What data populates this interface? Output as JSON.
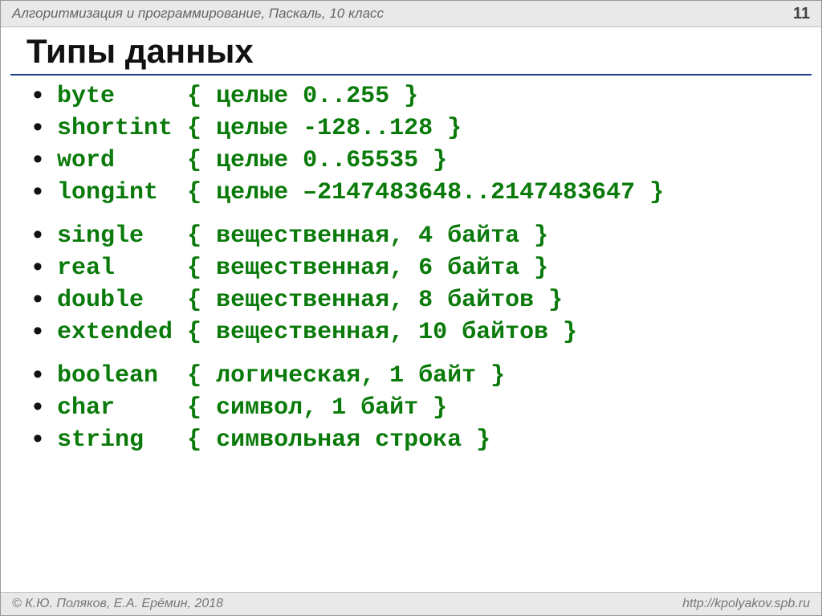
{
  "header": {
    "left": "Алгоритмизация и программирование, Паскаль, 10 класс",
    "page_number": "11"
  },
  "title": "Типы данных",
  "groups": [
    {
      "rows": [
        {
          "name": "byte",
          "pad": "    ",
          "comment": "{ целые 0..255 }"
        },
        {
          "name": "shortint",
          "pad": "",
          "comment": "{ целые -128..128 }"
        },
        {
          "name": "word",
          "pad": "    ",
          "comment": "{ целые 0..65535 }"
        },
        {
          "name": "longint",
          "pad": " ",
          "comment": "{ целые –2147483648..2147483647 }"
        }
      ]
    },
    {
      "rows": [
        {
          "name": "single",
          "pad": "  ",
          "comment": "{ вещественная, 4 байта }"
        },
        {
          "name": "real",
          "pad": "    ",
          "comment": "{ вещественная, 6 байта }"
        },
        {
          "name": "double",
          "pad": "  ",
          "comment": "{ вещественная, 8 байтов }"
        },
        {
          "name": "extended",
          "pad": "",
          "comment": "{ вещественная, 10 байтов }"
        }
      ]
    },
    {
      "rows": [
        {
          "name": "boolean",
          "pad": " ",
          "comment": "{ логическая, 1 байт }"
        },
        {
          "name": "char",
          "pad": "    ",
          "comment": "{ символ, 1 байт }"
        },
        {
          "name": "string",
          "pad": "  ",
          "comment": "{ символьная строка }"
        }
      ]
    }
  ],
  "footer": {
    "left": "© К.Ю. Поляков, Е.А. Ерёмин, 2018",
    "right": "http://kpolyakov.spb.ru"
  }
}
